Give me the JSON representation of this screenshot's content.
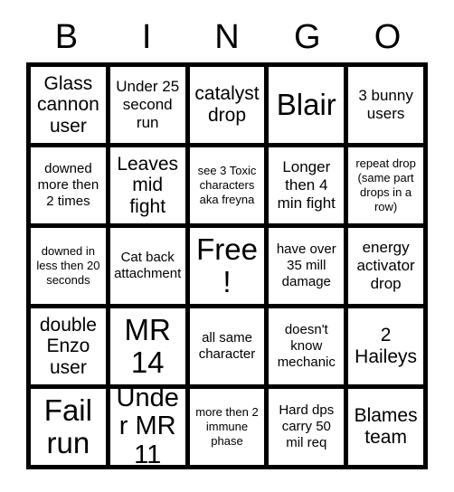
{
  "card": {
    "headers": [
      "B",
      "I",
      "N",
      "G",
      "O"
    ],
    "free_space_label": "Free!",
    "accent_color": "#000000",
    "background_color": "#ffffff",
    "rows": [
      [
        {
          "text": "Glass cannon user",
          "size": "l"
        },
        {
          "text": "Under 25 second run",
          "size": "m"
        },
        {
          "text": "catalyst drop",
          "size": "l"
        },
        {
          "text": "Blair",
          "size": "xxl"
        },
        {
          "text": "3 bunny users",
          "size": "m"
        }
      ],
      [
        {
          "text": "downed more then 2 times",
          "size": "s"
        },
        {
          "text": "Leaves mid fight",
          "size": "l"
        },
        {
          "text": "see 3 Toxic characters aka freyna",
          "size": "xs"
        },
        {
          "text": "Longer then 4 min fight",
          "size": "m"
        },
        {
          "text": "repeat drop (same part drops in a row)",
          "size": "xs"
        }
      ],
      [
        {
          "text": "downed in less then 20 seconds",
          "size": "xs"
        },
        {
          "text": "Cat back attachment",
          "size": "s"
        },
        {
          "text": "Free!",
          "size": "xxl"
        },
        {
          "text": "have over 35 mill damage",
          "size": "s"
        },
        {
          "text": "energy activator drop",
          "size": "m"
        }
      ],
      [
        {
          "text": "double Enzo user",
          "size": "l"
        },
        {
          "text": "MR 14",
          "size": "xxl"
        },
        {
          "text": "all same character",
          "size": "s"
        },
        {
          "text": "doesn't know mechanic",
          "size": "s"
        },
        {
          "text": "2 Haileys",
          "size": "l"
        }
      ],
      [
        {
          "text": "Fail run",
          "size": "xxl"
        },
        {
          "text": "Under MR 11",
          "size": "xl"
        },
        {
          "text": "more then 2 immune phase",
          "size": "xs"
        },
        {
          "text": "Hard dps carry 50 mil req",
          "size": "s"
        },
        {
          "text": "Blames team",
          "size": "l"
        }
      ]
    ]
  }
}
